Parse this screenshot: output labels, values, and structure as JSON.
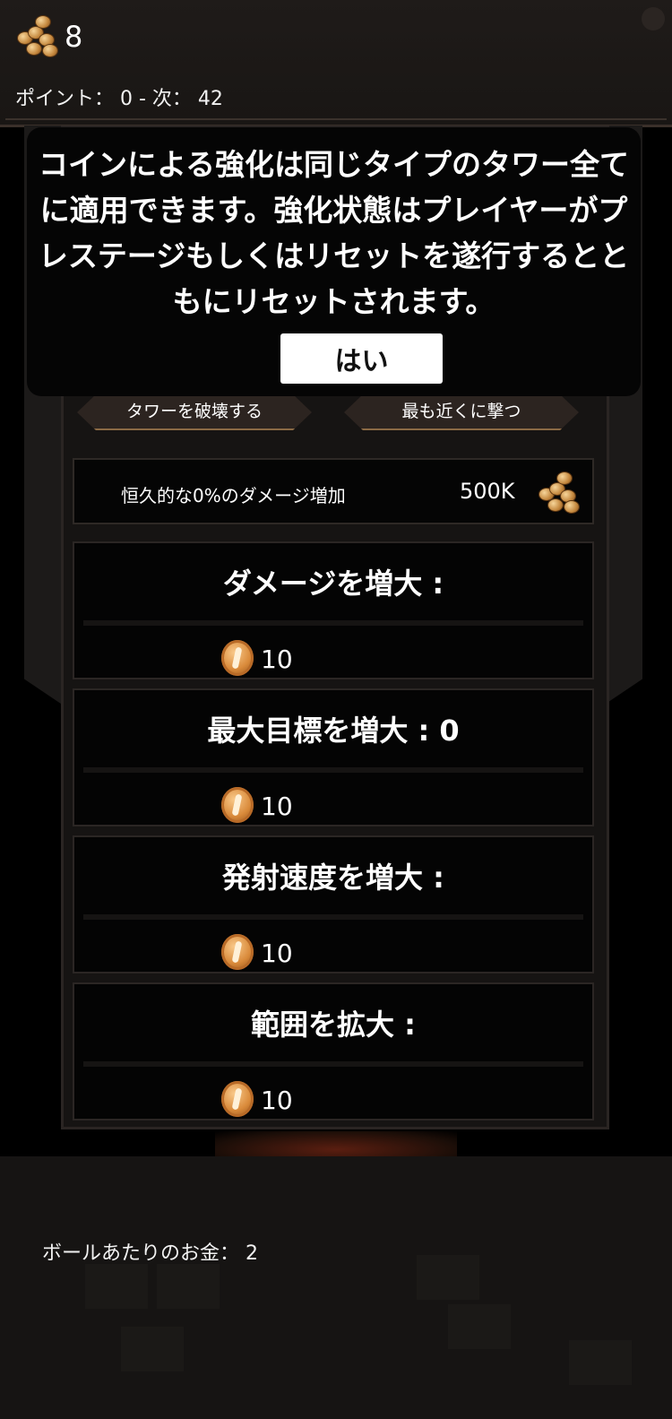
{
  "hud": {
    "coin_count": "8",
    "points_text": "ポイント： 0 - 次： 42"
  },
  "dialog": {
    "message": "コインによる強化は同じタイプのタワー全てに適用できます。強化状態はプレイヤーがプレステージもしくはリセットを遂行するとともにリセットされます。",
    "yes_label": "はい"
  },
  "actions": {
    "destroy_tower": "タワーを破壊する",
    "shoot_nearest": "最も近くに撃つ"
  },
  "permanent_boost": {
    "label": "恒久的な0%のダメージ増加",
    "cost": "500K"
  },
  "upgrades": [
    {
      "title": "ダメージを増大 :",
      "cost": "10"
    },
    {
      "title": "最大目標を増大 : 0",
      "cost": "10"
    },
    {
      "title": "発射速度を増大 :",
      "cost": "10"
    },
    {
      "title": "範囲を拡大 :",
      "cost": "10"
    }
  ],
  "bottom": {
    "money_per_ball": "ボールあたりのお金： 2"
  },
  "icons": {
    "coin_stack": "coin-stack-icon",
    "coin": "coin-icon"
  },
  "colors": {
    "background": "#000000",
    "panel": "#161413",
    "dialog": "#050505",
    "coin": "#d98a3a",
    "button_border": "#8b6a45"
  }
}
